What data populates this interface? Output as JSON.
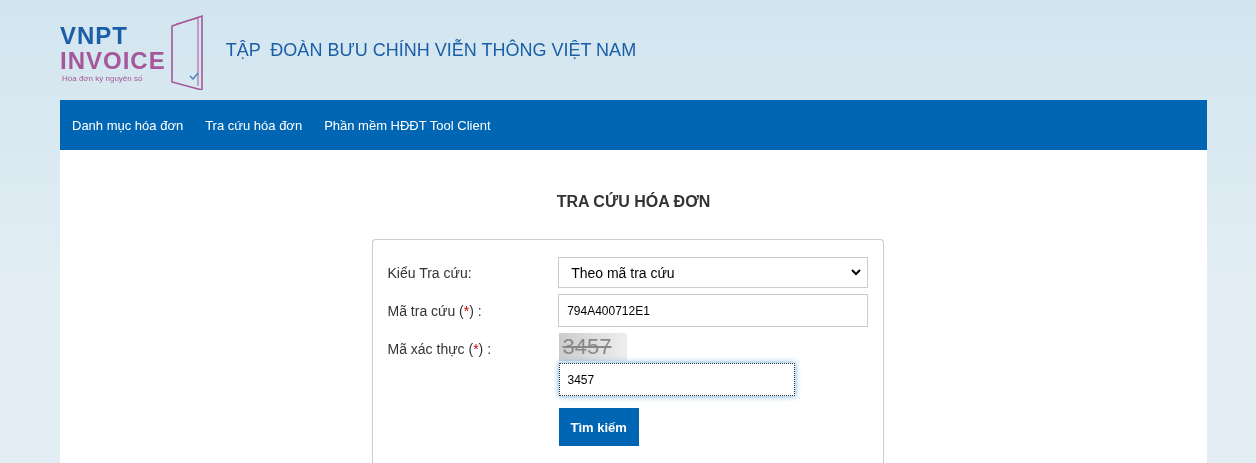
{
  "logo": {
    "line_1": "VNPT",
    "line_2": "INVOICE",
    "tagline": "Hóa đơn kỷ nguyên số"
  },
  "org_name": "TẬP  ĐOÀN BƯU CHÍNH VIỄN THÔNG VIỆT NAM",
  "nav": [
    "Danh mục hóa đơn",
    "Tra cứu hóa đơn",
    "Phần mềm HĐĐT Tool Client"
  ],
  "title": "TRA CỨU HÓA ĐƠN",
  "form": {
    "lookup_type": {
      "label": "Kiểu Tra cứu:",
      "value": "Theo mã tra cứu"
    },
    "lookup_code": {
      "label_before": "Mã tra cứu (",
      "required": "*",
      "label_after": ") :",
      "value": "794A400712E1"
    },
    "captcha": {
      "label_before": "Mã xác thực (",
      "required": "*",
      "label_after": ") :",
      "image_text": "3457",
      "value": "3457",
      "focused": true
    },
    "submit": "Tìm kiếm"
  }
}
